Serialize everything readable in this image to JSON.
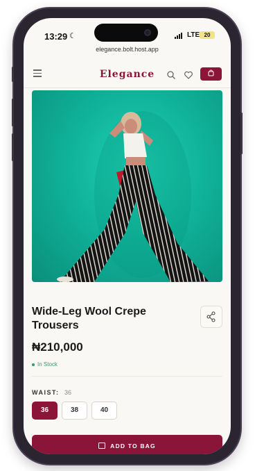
{
  "status_bar": {
    "time": "13:29",
    "network": "LTE",
    "battery": "20"
  },
  "browser": {
    "url": "elegance.bolt.host.app"
  },
  "header": {
    "brand": "Elegance"
  },
  "product": {
    "title": "Wide-Leg Wool Crepe Trousers",
    "price": "₦210,000",
    "stock_status": "In Stock"
  },
  "sizes": {
    "label": "WAIST:",
    "selected": "36",
    "options": [
      "36",
      "38",
      "40"
    ]
  },
  "cta": {
    "label": "ADD TO BAG"
  },
  "colors": {
    "accent": "#8b1538",
    "in_stock": "#2f9e6f",
    "photo_bg": "#10b39a"
  },
  "icons": [
    "menu-icon",
    "search-icon",
    "heart-icon",
    "bag-icon",
    "share-icon",
    "moon-icon",
    "signal-icon",
    "battery-icon"
  ]
}
